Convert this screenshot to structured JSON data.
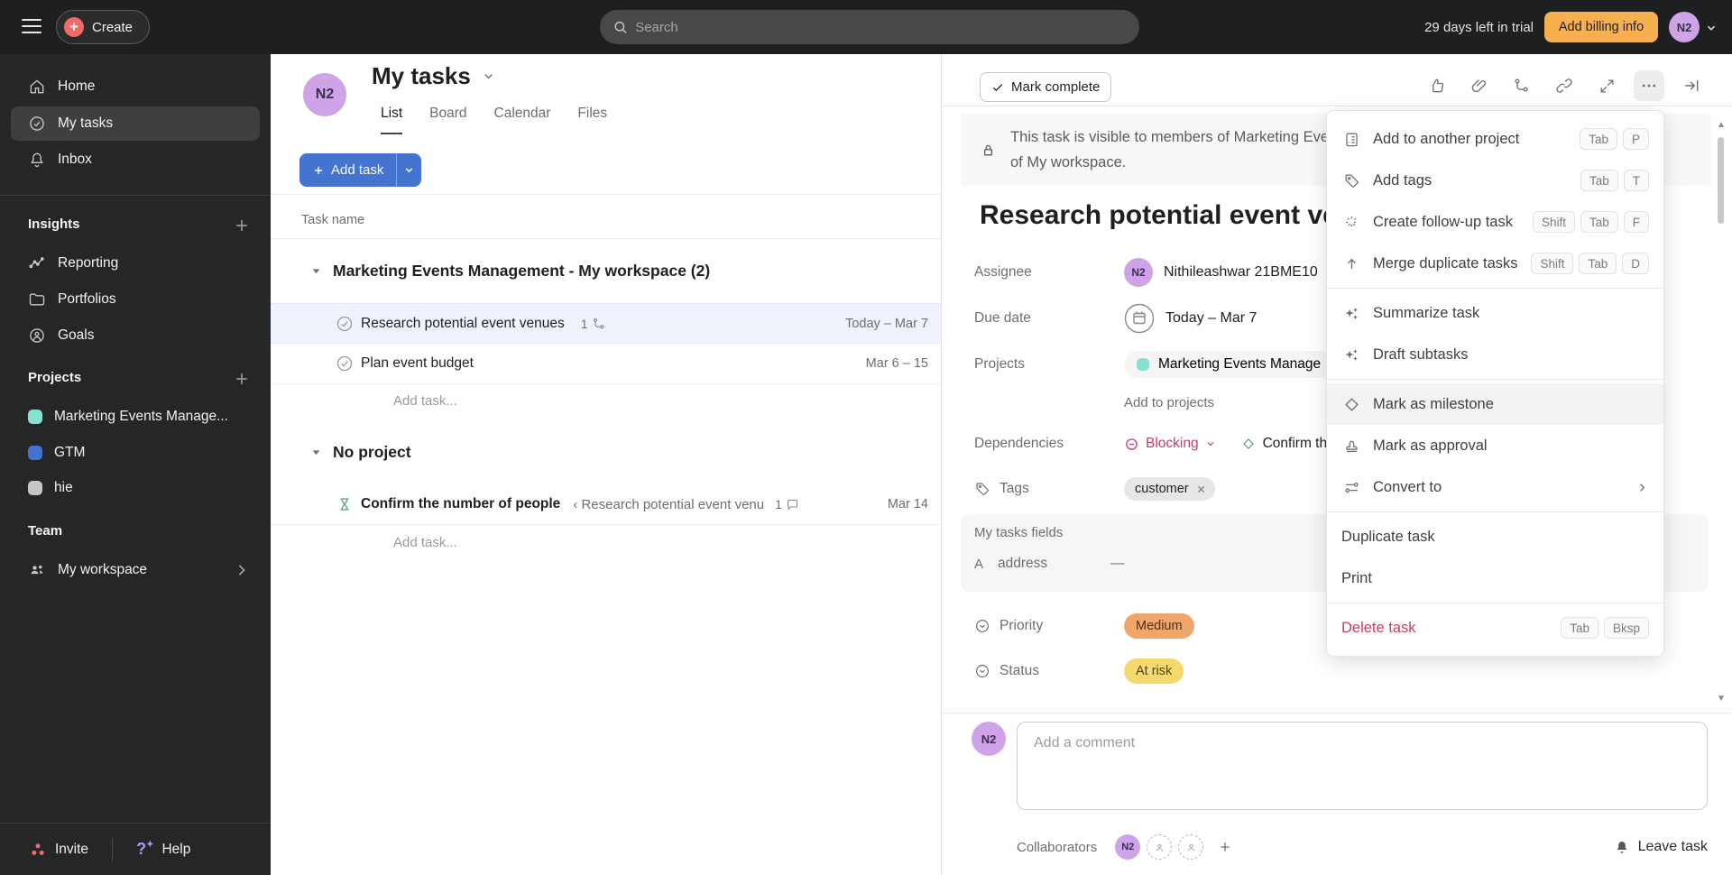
{
  "topbar": {
    "create_label": "Create",
    "search_placeholder": "Search",
    "trial_text": "29 days left in trial",
    "billing_button": "Add billing info",
    "avatar_initials": "N2"
  },
  "sidebar": {
    "items": [
      {
        "label": "Home"
      },
      {
        "label": "My tasks"
      },
      {
        "label": "Inbox"
      }
    ],
    "insights_title": "Insights",
    "insights": [
      {
        "label": "Reporting"
      },
      {
        "label": "Portfolios"
      },
      {
        "label": "Goals"
      }
    ],
    "projects_title": "Projects",
    "projects": [
      {
        "label": "Marketing Events Manage...",
        "color": "#86e0d3"
      },
      {
        "label": "GTM",
        "color": "#4573d2"
      },
      {
        "label": "hie",
        "color": "#c8c6c5"
      }
    ],
    "team_title": "Team",
    "team": [
      {
        "label": "My workspace"
      }
    ],
    "footer": {
      "invite": "Invite",
      "help": "Help"
    }
  },
  "list": {
    "avatar_initials": "N2",
    "title": "My tasks",
    "tabs": [
      {
        "label": "List"
      },
      {
        "label": "Board"
      },
      {
        "label": "Calendar"
      },
      {
        "label": "Files"
      }
    ],
    "add_task_label": "Add task",
    "column_header": "Task name",
    "section1": {
      "title": "Marketing Events Management - My workspace (2)",
      "rows": [
        {
          "name": "Research potential event venues",
          "subtask_count": "1",
          "date": "Today – Mar 7"
        },
        {
          "name": "Plan event budget",
          "date": "Mar 6 – 15"
        }
      ],
      "add_label": "Add task..."
    },
    "section2": {
      "title": "No project",
      "rows": [
        {
          "name": "Confirm the number of people",
          "parent": "‹ Research potential event venu",
          "comment_count": "1",
          "date": "Mar 14"
        }
      ],
      "add_label": "Add task..."
    }
  },
  "detail": {
    "mark_complete": "Mark complete",
    "banner_line1": "This task is visible to members of Marketing Events Management and is public to members",
    "banner_line2": "of My workspace.",
    "title": "Research potential event venues",
    "assignee_label": "Assignee",
    "assignee_value": "Nithileashwar 21BME10",
    "assignee_initials": "N2",
    "due_label": "Due date",
    "due_value": "Today – Mar 7",
    "projects_label": "Projects",
    "projects_value": "Marketing Events Manage",
    "add_to_projects": "Add to projects",
    "dependencies_label": "Dependencies",
    "blocking_label": "Blocking",
    "dependency_task": "Confirm the",
    "tags_label": "Tags",
    "tag_value": "customer",
    "fields_header": "My tasks fields",
    "address_icon": "A",
    "address_label": "address",
    "address_value": "—",
    "priority_label": "Priority",
    "priority_value": "Medium",
    "status_label": "Status",
    "status_value": "At risk",
    "comment_placeholder": "Add a comment",
    "collaborators_label": "Collaborators",
    "leave_task": "Leave task"
  },
  "menu": {
    "items": [
      {
        "label": "Add to another project",
        "shortcuts": [
          "Tab",
          "P"
        ]
      },
      {
        "label": "Add tags",
        "shortcuts": [
          "Tab",
          "T"
        ]
      },
      {
        "label": "Create follow-up task",
        "shortcuts": [
          "Shift",
          "Tab",
          "F"
        ]
      },
      {
        "label": "Merge duplicate tasks",
        "shortcuts": [
          "Shift",
          "Tab",
          "D"
        ]
      },
      {
        "label": "Summarize task"
      },
      {
        "label": "Draft subtasks"
      },
      {
        "label": "Mark as milestone"
      },
      {
        "label": "Mark as approval"
      },
      {
        "label": "Convert to"
      },
      {
        "label": "Duplicate task"
      },
      {
        "label": "Print"
      },
      {
        "label": "Delete task",
        "shortcuts": [
          "Tab",
          "Bksp"
        ]
      }
    ]
  },
  "colors": {
    "accent_blue": "#4573d2",
    "billing_amber": "#f8b04e",
    "avatar_purple": "#cfa3e8",
    "blocking_red": "#c53e69",
    "priority_medium_bg": "#f0a56b",
    "status_at_risk_bg": "#f6d96e",
    "danger_red": "#ca3d5f"
  }
}
